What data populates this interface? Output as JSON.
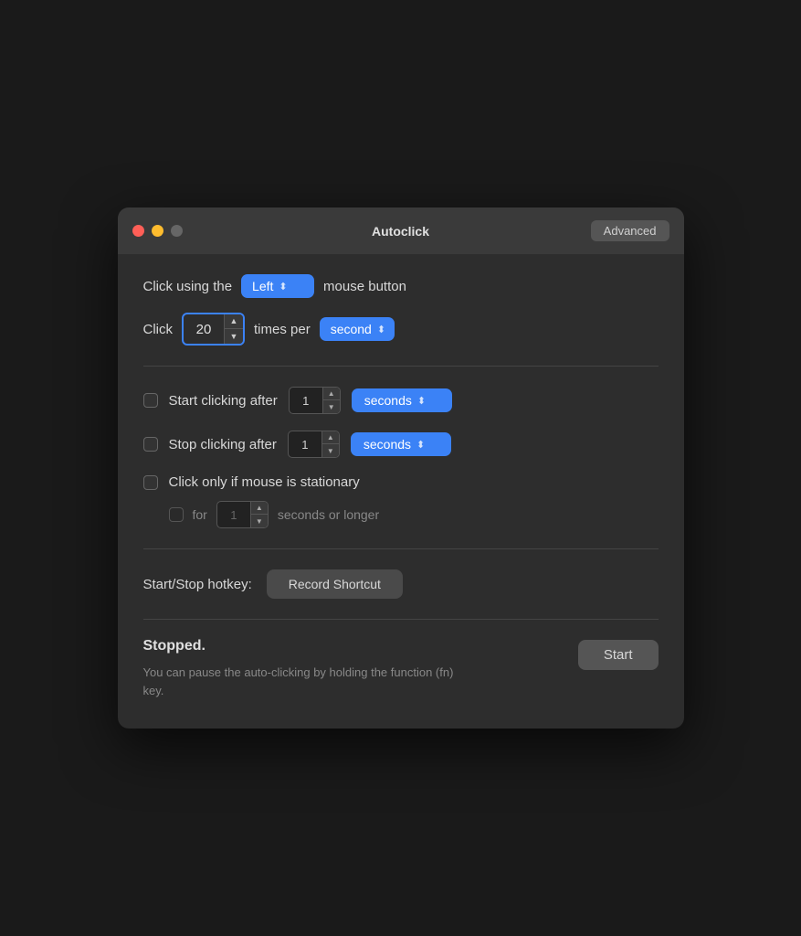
{
  "window": {
    "title": "Autoclick",
    "advanced_label": "Advanced"
  },
  "section1": {
    "click_using_prefix": "Click using the",
    "mouse_button_suffix": "mouse button",
    "mouse_button_value": "Left",
    "click_prefix": "Click",
    "times_per_label": "times per",
    "click_count_value": "20",
    "frequency_value": "second"
  },
  "section2": {
    "start_after_label": "Start clicking after",
    "start_after_value": "1",
    "start_unit": "seconds",
    "stop_after_label": "Stop clicking after",
    "stop_after_value": "1",
    "stop_unit": "seconds",
    "stationary_label": "Click only if mouse is stationary",
    "stationary_for_label": "for",
    "stationary_value": "1",
    "stationary_suffix": "seconds or longer"
  },
  "section3": {
    "hotkey_label": "Start/Stop hotkey:",
    "record_button_label": "Record Shortcut"
  },
  "section4": {
    "status_text": "Stopped.",
    "hint_text": "You can pause the auto-clicking by holding the function (fn) key.",
    "start_button_label": "Start"
  },
  "icons": {
    "up_arrow": "▲",
    "down_arrow": "▼",
    "dropdown_arrow": "⬍"
  }
}
